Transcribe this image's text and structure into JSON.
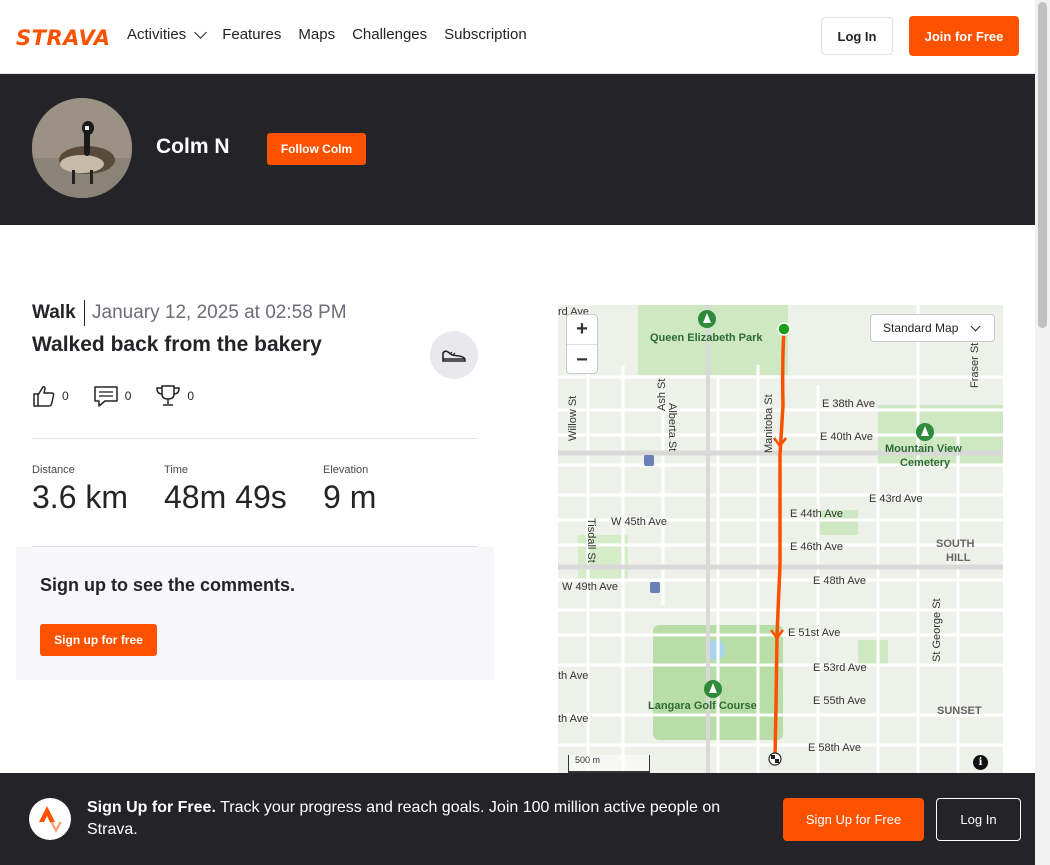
{
  "nav": {
    "logo": "STRAVA",
    "links": [
      "Activities",
      "Features",
      "Maps",
      "Challenges",
      "Subscription"
    ],
    "login": "Log In",
    "join": "Join for Free"
  },
  "athlete": {
    "name": "Colm N",
    "follow": "Follow Colm"
  },
  "activity": {
    "type": "Walk",
    "date": "January 12, 2025 at 02:58 PM",
    "title": "Walked back from the bakery",
    "kudos": "0",
    "comments": "0",
    "achievements": "0",
    "stats": [
      {
        "label": "Distance",
        "value": "3.6 km"
      },
      {
        "label": "Time",
        "value": "48m 49s"
      },
      {
        "label": "Elevation",
        "value": "9 m"
      }
    ]
  },
  "comments_panel": {
    "message": "Sign up to see the comments.",
    "button": "Sign up for free"
  },
  "map": {
    "style_select": "Standard Map",
    "zoom_in": "+",
    "zoom_out": "−",
    "scale": "500 m",
    "labels": {
      "park": "Queen Elizabeth Park",
      "cemetery1": "Mountain View",
      "cemetery2": "Cemetery",
      "golf": "Langara Golf Course",
      "south_hill1": "SOUTH",
      "south_hill2": "HILL",
      "sunset": "SUNSET",
      "e38": "E 38th Ave",
      "e40": "E 40th Ave",
      "e43": "E 43rd Ave",
      "e44": "E 44th Ave",
      "e46": "E 46th Ave",
      "e48": "E 48th Ave",
      "e51": "E 51st Ave",
      "e53": "E 53rd Ave",
      "e55": "E 55th Ave",
      "e58": "E 58th Ave",
      "w45": "W 45th Ave",
      "w49": "W 49th Ave",
      "ash": "Ash St",
      "alberta": "Alberta St",
      "manitoba": "Manitoba St",
      "fraser": "Fraser St",
      "stgeorge": "St George St",
      "tisdall": "Tisdall St",
      "willow": "Willow St",
      "rd_ave": "rd Ave",
      "th_ave": "th Ave"
    },
    "route_color": "#fc5200"
  },
  "banner": {
    "headline": "Sign Up for Free.",
    "text": " Track your progress and reach goals. Join 100 million active people on Strava.",
    "signup": "Sign Up for Free",
    "login": "Log In"
  },
  "colors": {
    "brand": "#fc5200",
    "dark": "#242428"
  }
}
